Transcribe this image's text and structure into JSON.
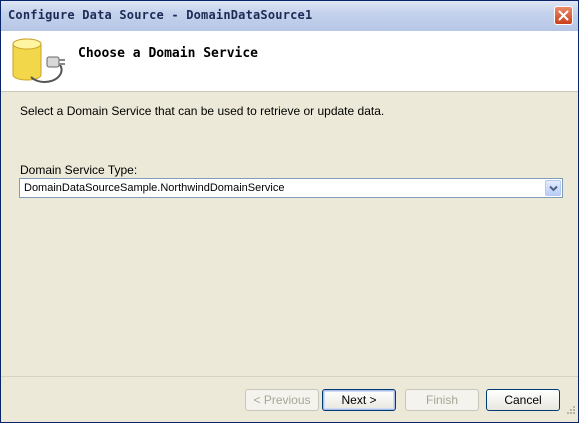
{
  "window": {
    "title": "Configure Data Source - DomainDataSource1"
  },
  "header": {
    "title": "Choose a Domain Service",
    "icon": "database-plug-icon"
  },
  "main": {
    "description": "Select a Domain Service that can be used to retrieve or update data.",
    "field_label": "Domain Service Type:",
    "selected_value": "DomainDataSourceSample.NorthwindDomainService"
  },
  "buttons": {
    "previous": "< Previous",
    "next": "Next >",
    "finish": "Finish",
    "cancel": "Cancel"
  },
  "colors": {
    "close_button": "#c8401b",
    "titlebar": "#c4d2ec",
    "dialog_bg": "#ece9d8"
  }
}
